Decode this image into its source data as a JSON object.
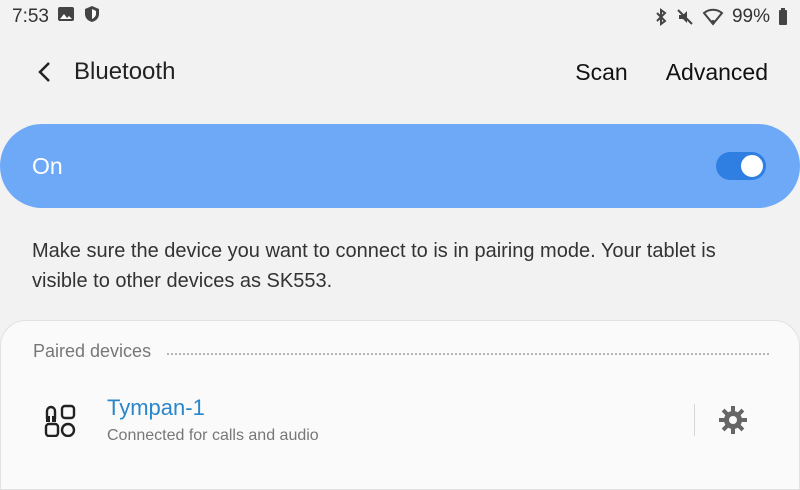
{
  "status_bar": {
    "time": "7:53",
    "battery": "99%",
    "icons": [
      "image-icon",
      "shield-icon",
      "bluetooth-icon",
      "mute-icon",
      "wifi-icon",
      "battery-icon"
    ]
  },
  "app_bar": {
    "title": "Bluetooth",
    "scan_label": "Scan",
    "advanced_label": "Advanced"
  },
  "master_toggle": {
    "label": "On",
    "state": true,
    "accent_color": "#6da9f7"
  },
  "info": {
    "text": "Make sure the device you want to connect to is in pairing mode. Your tablet is visible to other devices as SK553."
  },
  "paired": {
    "title": "Paired devices",
    "devices": [
      {
        "name": "Tympan-1",
        "status": "Connected for calls and audio",
        "icon": "headset-device-icon"
      }
    ]
  }
}
